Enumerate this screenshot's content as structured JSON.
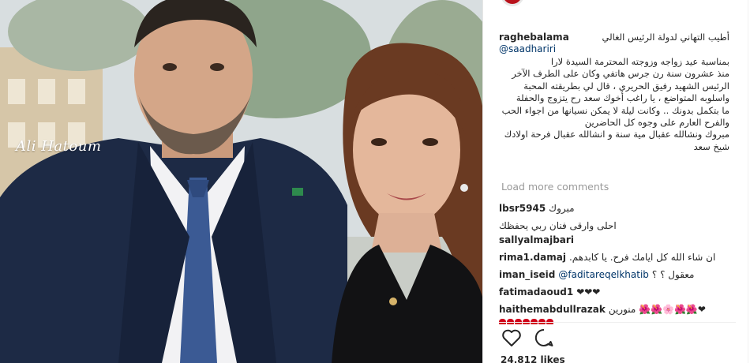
{
  "photo": {
    "watermark": "Ali Hatoum"
  },
  "post": {
    "username": "raghebalama",
    "caption_lines": [
      "أطيب التهاني لدولة الرئيس الغالي",
      "@saadhariri",
      "بمناسبة عيد زواجه وزوجته المحترمة السيدة لارا",
      "منذ عشرون سنة رن جرس هاتفي وكان على الطرف الآخر",
      "الرئيس الشهيد رفيق الحريري ، قال لي بطريقته المحبة",
      "واسلوبه المتواضع ، يا راغب أخوك سعد رح يتزوج والحفلة",
      "ما بتكمل بدونك .. وكانت ليلة لا يمكن نسيانها من اجواء الحب",
      "والفرح العارم على وجوه كل الحاضرين",
      "مبروك ونشالله عقبال مية سنة و انشالله عقبال فرحة اولادك",
      "شيخ سعد"
    ],
    "load_more": "Load more comments",
    "comments": [
      {
        "user": "lbsr5945",
        "text": "مبروك"
      },
      {
        "user": "",
        "text": "احلى وارقى فنان ربي يحفظك"
      },
      {
        "user": "sallyalmajbari",
        "text": ""
      },
      {
        "user": "rima1.damaj",
        "text": ".ان شاء الله كل ايامك فرح. يا كابدهم"
      },
      {
        "user": "iman_iseid",
        "mention": "@faditareqelkhatib",
        "text": "معقول ؟ ؟"
      },
      {
        "user": "fatimadaoud1",
        "text": "❤❤❤"
      },
      {
        "user": "haithemabdullrazak",
        "text": "منورين 🌺🌺🌸🌺🌺❤"
      }
    ],
    "likes": "24,812 likes"
  },
  "icons": {
    "like": "heart-outline-icon",
    "comment": "comment-bubble-icon"
  },
  "colors": {
    "text": "#262626",
    "muted": "#999999",
    "link": "#003569",
    "heart": "#d0021b"
  }
}
